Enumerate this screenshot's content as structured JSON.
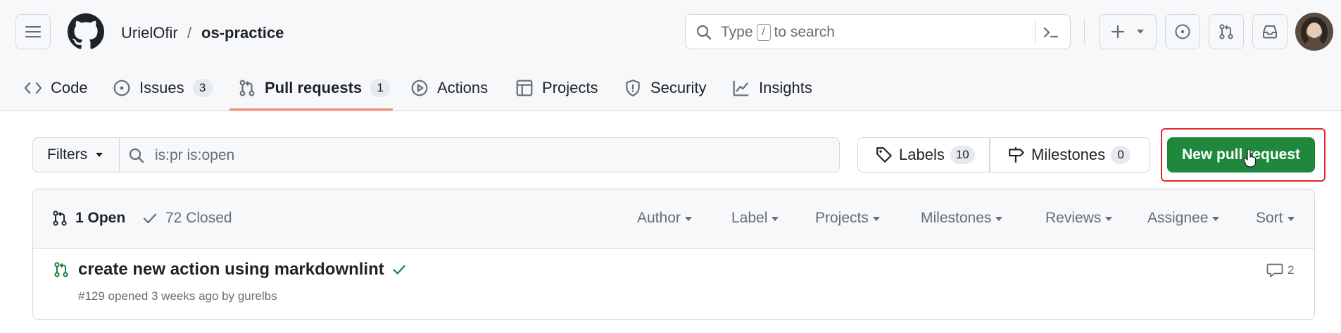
{
  "repo": {
    "owner": "UrielOfir",
    "separator": "/",
    "name": "os-practice"
  },
  "search": {
    "prefix": "Type",
    "key": "/",
    "suffix": "to search"
  },
  "tabs": [
    {
      "label": "Code",
      "icon": "code-icon"
    },
    {
      "label": "Issues",
      "count": "3",
      "icon": "issue-icon"
    },
    {
      "label": "Pull requests",
      "count": "1",
      "icon": "git-pull-request-icon",
      "active": true
    },
    {
      "label": "Actions",
      "icon": "play-icon"
    },
    {
      "label": "Projects",
      "icon": "table-icon"
    },
    {
      "label": "Security",
      "icon": "shield-icon"
    },
    {
      "label": "Insights",
      "icon": "graph-icon"
    }
  ],
  "filters": {
    "button_label": "Filters",
    "query": "is:pr is:open"
  },
  "labels": {
    "label": "Labels",
    "count": "10"
  },
  "milestones": {
    "label": "Milestones",
    "count": "0"
  },
  "new_pr": {
    "label": "New pull request"
  },
  "list": {
    "open_label": "1 Open",
    "closed_label": "72 Closed",
    "sorters": [
      "Author",
      "Label",
      "Projects",
      "Milestones",
      "Reviews",
      "Assignee",
      "Sort"
    ]
  },
  "pulls": [
    {
      "title": "create new action using markdownlint",
      "meta": "#129 opened 3 weeks ago by gurelbs",
      "comments": "2"
    }
  ],
  "colors": {
    "primary_button": "#1f883d",
    "active_tab_underline": "#fd8c73",
    "highlight_box": "#e5262b",
    "open_state": "#1a7f37"
  }
}
